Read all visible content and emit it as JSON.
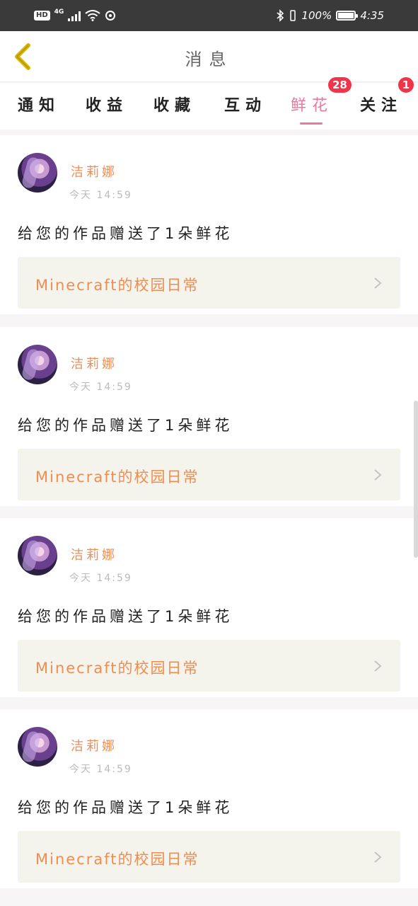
{
  "status_bar": {
    "hd": "HD",
    "network": "4G",
    "battery_text": "100%",
    "time": "4:35"
  },
  "header": {
    "title": "消息",
    "back_icon": "chevron-left-icon",
    "back_color": "#d9b400"
  },
  "tabs": [
    {
      "label": "通知",
      "active": false
    },
    {
      "label": "收益",
      "active": false
    },
    {
      "label": "收藏",
      "active": false
    },
    {
      "label": "互动",
      "active": false
    },
    {
      "label": "鲜花",
      "active": true,
      "badge": "28"
    },
    {
      "label": "关注",
      "active": false,
      "badge": "1"
    }
  ],
  "accent_color": "#e8799f",
  "badge_color": "#f0354a",
  "messages": [
    {
      "user": "洁莉娜",
      "time": "今天 14:59",
      "text": "给您的作品赠送了1朵鲜花",
      "work_title": "Minecraft的校园日常"
    },
    {
      "user": "洁莉娜",
      "time": "今天 14:59",
      "text": "给您的作品赠送了1朵鲜花",
      "work_title": "Minecraft的校园日常"
    },
    {
      "user": "洁莉娜",
      "time": "今天 14:59",
      "text": "给您的作品赠送了1朵鲜花",
      "work_title": "Minecraft的校园日常"
    },
    {
      "user": "洁莉娜",
      "time": "今天 14:59",
      "text": "给您的作品赠送了1朵鲜花",
      "work_title": "Minecraft的校园日常"
    }
  ]
}
